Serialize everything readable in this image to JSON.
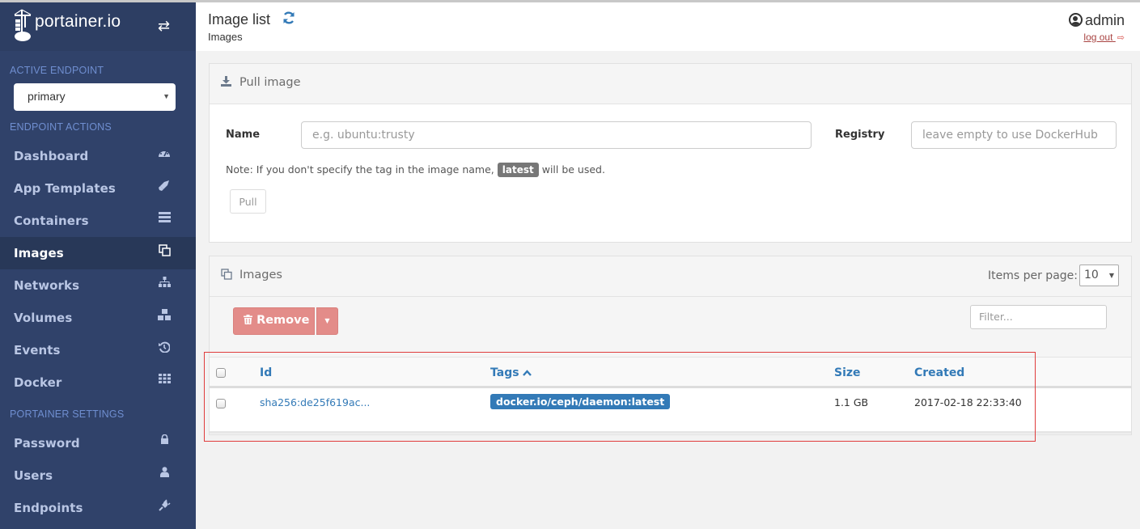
{
  "brand": {
    "name": "portainer.io",
    "toggle_icon": "exchange-icon"
  },
  "sidebar": {
    "active_endpoint_title": "ACTIVE ENDPOINT",
    "endpoint_selected": "primary",
    "endpoint_actions_title": "ENDPOINT ACTIONS",
    "items": [
      {
        "label": "Dashboard",
        "icon": "tachometer-icon",
        "glyph": "◔"
      },
      {
        "label": "App Templates",
        "icon": "rocket-icon",
        "glyph": "➚"
      },
      {
        "label": "Containers",
        "icon": "server-icon",
        "glyph": "☰"
      },
      {
        "label": "Images",
        "icon": "clone-icon",
        "glyph": "⧉",
        "active": true
      },
      {
        "label": "Networks",
        "icon": "sitemap-icon",
        "glyph": "⊥"
      },
      {
        "label": "Volumes",
        "icon": "cubes-icon",
        "glyph": "❖"
      },
      {
        "label": "Events",
        "icon": "history-icon",
        "glyph": "↺"
      },
      {
        "label": "Docker",
        "icon": "th-icon",
        "glyph": "▦"
      }
    ],
    "portainer_settings_title": "PORTAINER SETTINGS",
    "settings_items": [
      {
        "label": "Password",
        "icon": "lock-icon",
        "glyph": "🔒"
      },
      {
        "label": "Users",
        "icon": "user-icon",
        "glyph": "👤"
      },
      {
        "label": "Endpoints",
        "icon": "plug-icon",
        "glyph": "⚡"
      }
    ]
  },
  "header": {
    "title": "Image list",
    "breadcrumb": "Images",
    "username": "admin",
    "logout_label": "log out"
  },
  "pull_image": {
    "title": "Pull image",
    "name_label": "Name",
    "name_placeholder": "e.g. ubuntu:trusty",
    "name_value": "",
    "registry_label": "Registry",
    "registry_placeholder": "leave empty to use DockerHub",
    "registry_value": "",
    "note_before": "Note: If you don't specify the tag in the image name,",
    "note_badge": "latest",
    "note_after": "will be used.",
    "pull_button": "Pull"
  },
  "images": {
    "title": "Images",
    "items_per_page_label": "Items per page:",
    "items_per_page_value": "10",
    "remove_button": "Remove",
    "filter_placeholder": "Filter...",
    "columns": [
      "Id",
      "Tags",
      "Size",
      "Created"
    ],
    "sort_column": "Tags",
    "sort_direction": "asc",
    "rows": [
      {
        "id": "sha256:de25f619ac...",
        "tags": [
          "docker.io/ceph/daemon:latest"
        ],
        "size": "1.1 GB",
        "created": "2017-02-18 22:33:40"
      }
    ]
  },
  "annotation": {
    "highlight_color": "#e03c3c"
  },
  "colors": {
    "sidebar_bg": "#30426a",
    "accent": "#337ab7",
    "danger": "#e38c89"
  }
}
